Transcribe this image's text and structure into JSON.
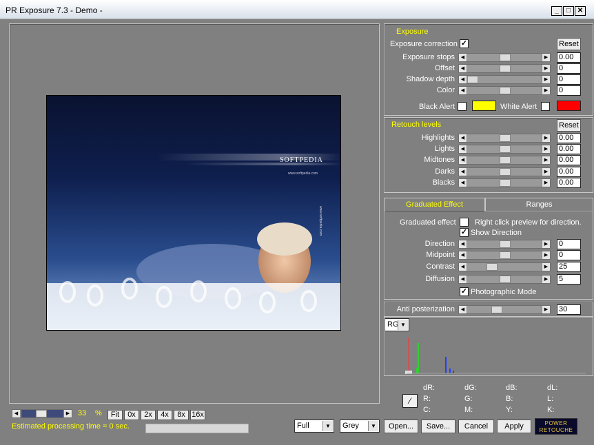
{
  "window": {
    "title": "PR Exposure 7.3 - Demo -"
  },
  "window_controls": {
    "minimize": "_",
    "maximize": "□",
    "close": "✕"
  },
  "exposure": {
    "header": "Exposure",
    "correction_label": "Exposure correction",
    "correction_checked": "✓",
    "reset_label": "Reset",
    "rows": [
      {
        "label": "Exposure stops",
        "value": "0.00",
        "level": 0.5
      },
      {
        "label": "Offset",
        "value": "0",
        "level": 0.5
      },
      {
        "label": "Shadow depth",
        "value": "0",
        "level": 0.0
      },
      {
        "label": "Color",
        "value": "0",
        "level": 0.5
      }
    ],
    "black_alert_label": "Black Alert",
    "white_alert_label": "White Alert",
    "black_alert_color": "#ffff00",
    "white_alert_color": "#ff0000"
  },
  "retouch": {
    "header": "Retouch levels",
    "reset_label": "Reset",
    "rows": [
      {
        "label": "Highlights",
        "value": "0.00",
        "level": 0.5
      },
      {
        "label": "Lights",
        "value": "0.00",
        "level": 0.5
      },
      {
        "label": "Midtones",
        "value": "0.00",
        "level": 0.5
      },
      {
        "label": "Darks",
        "value": "0.00",
        "level": 0.5
      },
      {
        "label": "Blacks",
        "value": "0.00",
        "level": 0.5
      }
    ]
  },
  "graduated": {
    "tab_effect": "Graduated Effect",
    "tab_ranges": "Ranges",
    "effect_label": "Graduated effect",
    "hint": "Right click preview for direction.",
    "show_direction_label": "Show Direction",
    "show_direction_checked": "✓",
    "rows": [
      {
        "label": "Direction",
        "value": "0",
        "level": 0.5
      },
      {
        "label": "Midpoint",
        "value": "0",
        "level": 0.5
      },
      {
        "label": "Contrast",
        "value": "25",
        "level": 0.3
      },
      {
        "label": "Diffusion",
        "value": "5",
        "level": 0.5
      }
    ],
    "photographic_label": "Photographic Mode",
    "photographic_checked": "✓"
  },
  "anti_posterization": {
    "label": "Anti posterization",
    "value": "30",
    "level": 0.37
  },
  "histogram": {
    "channel": "RG",
    "readouts": {
      "dR": "dR:",
      "dG": "dG:",
      "dB": "dB:",
      "dL": "dL:",
      "R": "R:",
      "G": "G:",
      "B": "B:",
      "L": "L:",
      "C": "C:",
      "M": "M:",
      "Y": "Y:",
      "K": "K:"
    }
  },
  "preview": {
    "watermark": "SOFTPEDIA",
    "watermark_sub": "www.softpedia.com",
    "side_text": "www.softpedia.com"
  },
  "zoom": {
    "value": "33",
    "unit": "%",
    "buttons": [
      "Fit",
      "0x",
      "2x",
      "4x",
      "8x",
      "16x"
    ],
    "level": 0.45
  },
  "status": {
    "processing": "Estimated processing time =  0 sec."
  },
  "bottom": {
    "mode": "Full",
    "bg": "Grey",
    "open": "Open...",
    "save": "Save...",
    "cancel": "Cancel",
    "apply": "Apply",
    "logo_line1": "POWER",
    "logo_line2": "RETOUCHE"
  }
}
